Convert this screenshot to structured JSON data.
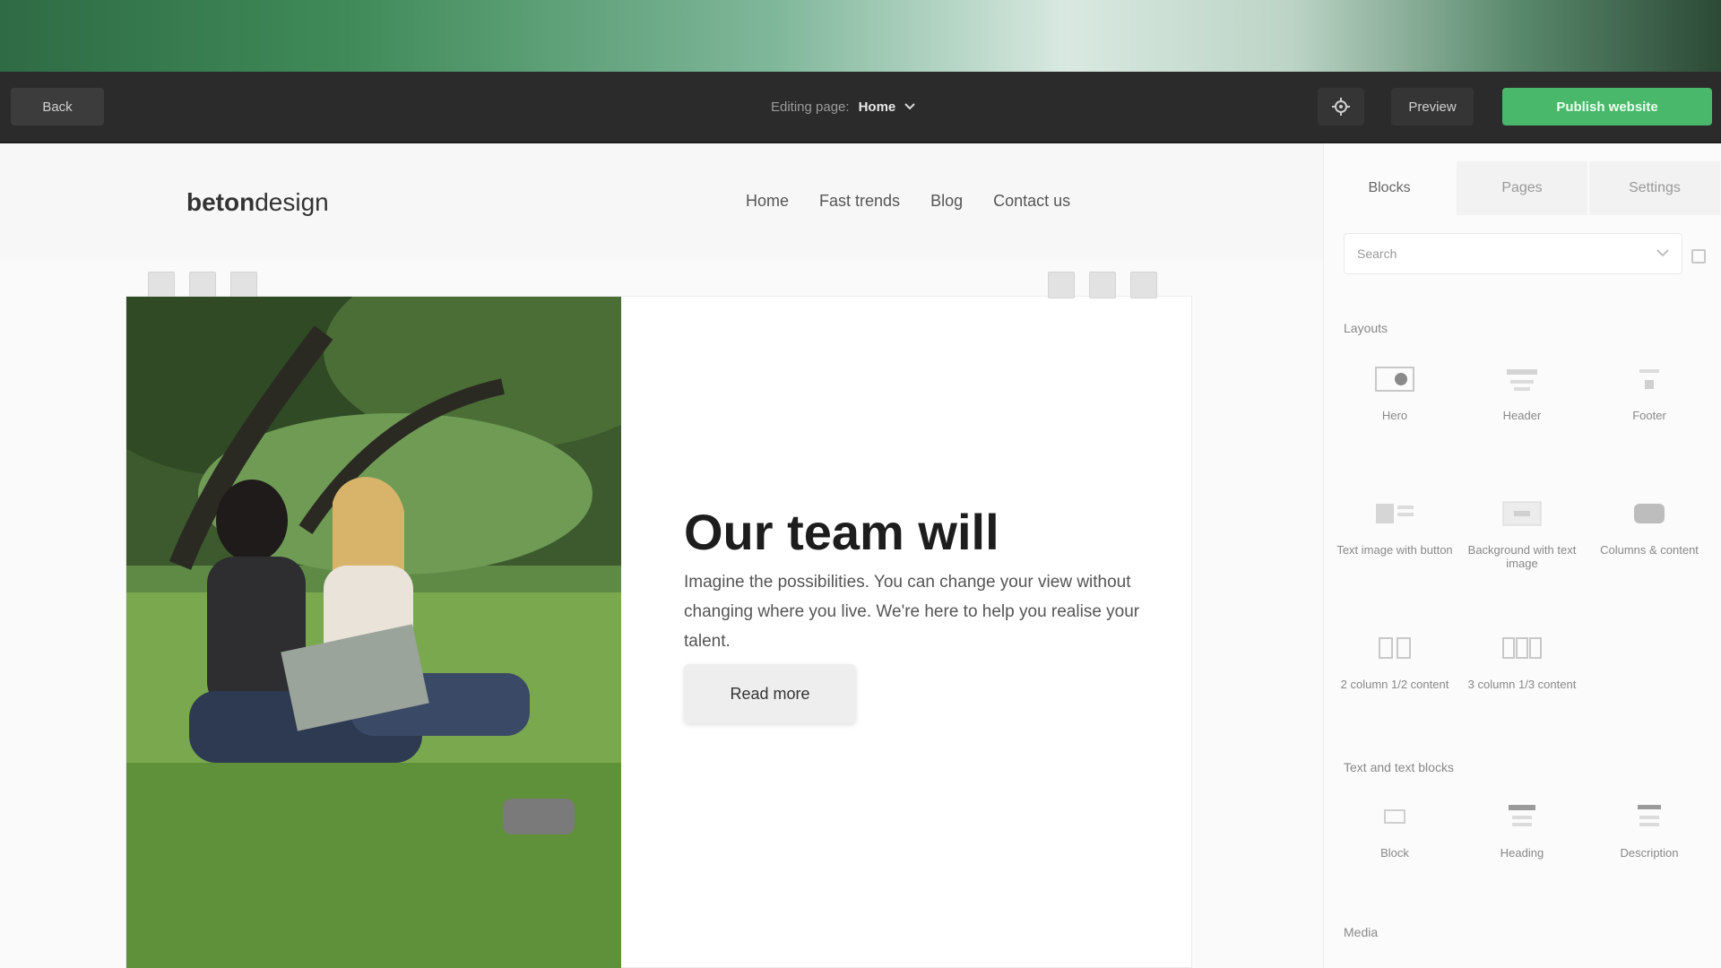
{
  "toolbar": {
    "back_label": "Back",
    "page_prefix": "Editing page:",
    "page_name": "Home",
    "preview_label": "Preview",
    "publish_label": "Publish website"
  },
  "site": {
    "logo_bold": "beton",
    "logo_rest": "design",
    "nav": [
      "Home",
      "Fast trends",
      "Blog",
      "Contact us"
    ]
  },
  "hero": {
    "title": "Our team will",
    "body": "Imagine the possibilities. You can change your view without changing where you live. We're here to help you realise your talent.",
    "button": "Read more"
  },
  "panel": {
    "tabs": [
      "Blocks",
      "Pages",
      "Settings"
    ],
    "search_placeholder": "Search",
    "section_layouts": "Layouts",
    "layouts": [
      {
        "label": "Hero"
      },
      {
        "label": "Header"
      },
      {
        "label": "Footer"
      },
      {
        "label": "Text image with button"
      },
      {
        "label": "Background with text image"
      },
      {
        "label": "Columns & content"
      },
      {
        "label": "2 column 1/2 content"
      },
      {
        "label": "3 column 1/3 content"
      }
    ],
    "section_text": "Text and text blocks",
    "text_items": [
      {
        "label": "Block"
      },
      {
        "label": "Heading"
      },
      {
        "label": "Description"
      }
    ],
    "section_media": "Media"
  },
  "colors": {
    "toolbar_bg": "#2b2b2b",
    "publish_green": "#49b86a",
    "top_gradient": "#3f8a58"
  }
}
